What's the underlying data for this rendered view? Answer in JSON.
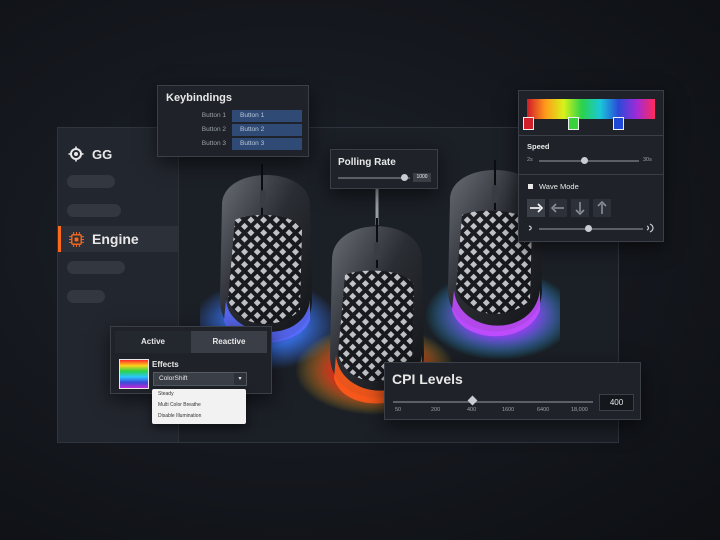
{
  "sidebar": {
    "brand": "GG",
    "active_item": "Engine",
    "accent_color": "#ff6a1a"
  },
  "keybindings": {
    "title": "Keybindings",
    "rows": [
      {
        "key": "Button 1",
        "value": "Button 1"
      },
      {
        "key": "Button 2",
        "value": "Button 2"
      },
      {
        "key": "Button 3",
        "value": "Button 3"
      }
    ]
  },
  "polling": {
    "title": "Polling Rate",
    "value": "1000",
    "level": 0.93
  },
  "color_panel": {
    "speed_label": "Speed",
    "speed_min": "2s",
    "speed_max": "30s",
    "speed_level": 0.45,
    "wave_mode_label": "Wave Mode",
    "stop_colors": [
      "#d0202a",
      "#3ad23a",
      "#2048d8"
    ]
  },
  "cpi": {
    "title": "CPI Levels",
    "ticks": [
      "50",
      "200",
      "400",
      "1600",
      "6400",
      "18,000"
    ],
    "value": "400"
  },
  "effects": {
    "tabs": [
      "Active",
      "Reactive"
    ],
    "label": "Effects",
    "selected": "ColorShift",
    "options": [
      "Steady",
      "Multi Color Breathe",
      "Disable Illumination"
    ]
  }
}
